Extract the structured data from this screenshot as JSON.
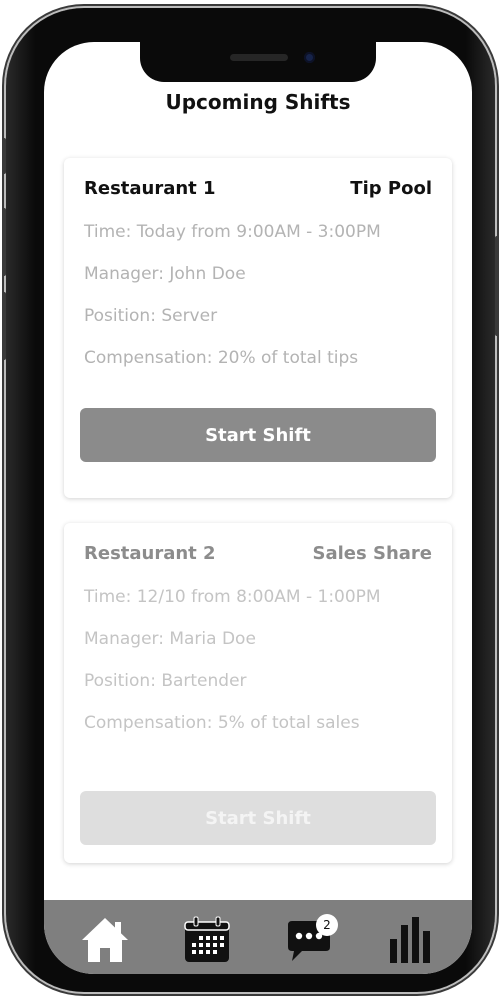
{
  "page": {
    "title": "Upcoming Shifts"
  },
  "shifts": [
    {
      "restaurant": "Restaurant 1",
      "type": "Tip Pool",
      "time": "Time: Today from 9:00AM - 3:00PM",
      "manager": "Manager: John Doe",
      "position": "Position: Server",
      "compensation": "Compensation: 20% of total tips",
      "button_label": "Start Shift",
      "enabled": true
    },
    {
      "restaurant": "Restaurant 2",
      "type": "Sales Share",
      "time": "Time: 12/10 from 8:00AM - 1:00PM",
      "manager": "Manager: Maria Doe",
      "position": "Position: Bartender",
      "compensation": "Compensation: 5% of total sales",
      "button_label": "Start Shift",
      "enabled": false
    }
  ],
  "nav": {
    "items": [
      {
        "icon": "home-icon"
      },
      {
        "icon": "calendar-icon"
      },
      {
        "icon": "chat-icon",
        "badge": "2"
      },
      {
        "icon": "bar-chart-icon"
      }
    ]
  },
  "colors": {
    "nav_background": "#7f7f7f",
    "primary_button": "#8b8b8b",
    "disabled_button": "#dedede"
  }
}
